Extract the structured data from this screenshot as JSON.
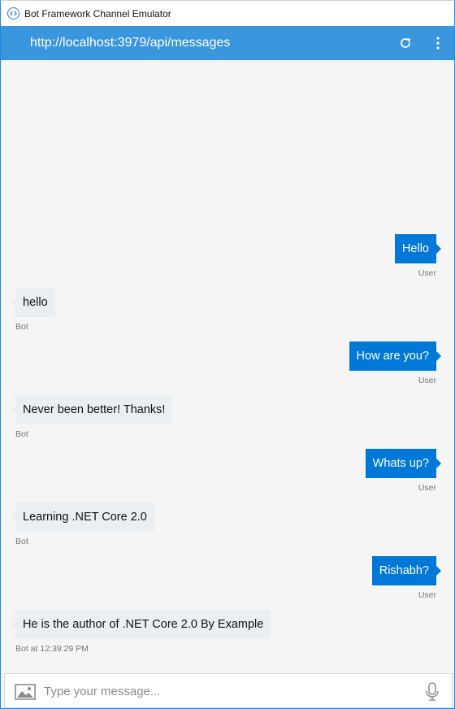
{
  "window": {
    "title": "Bot Framework Channel Emulator"
  },
  "addressbar": {
    "url": "http://localhost:3979/api/messages"
  },
  "conversation": [
    {
      "from": "user",
      "text": "Hello",
      "sender_label": "User"
    },
    {
      "from": "bot",
      "text": "hello",
      "sender_label": "Bot"
    },
    {
      "from": "user",
      "text": "How are you?",
      "sender_label": "User"
    },
    {
      "from": "bot",
      "text": "Never been better! Thanks!",
      "sender_label": "Bot"
    },
    {
      "from": "user",
      "text": "Whats up?",
      "sender_label": "User"
    },
    {
      "from": "bot",
      "text": "Learning .NET Core 2.0",
      "sender_label": "Bot"
    },
    {
      "from": "user",
      "text": "Rishabh?",
      "sender_label": "User"
    },
    {
      "from": "bot",
      "text": "He is the author of .NET Core 2.0 By Example",
      "sender_label": "Bot at 12:39:29 PM"
    }
  ],
  "input": {
    "placeholder": "Type your message..."
  },
  "icons": {
    "app": "emulator-icon",
    "refresh": "refresh-icon",
    "more": "more-vertical-icon",
    "image": "image-upload-icon",
    "mic": "microphone-icon"
  },
  "colors": {
    "accent": "#3a96dd",
    "user_bubble": "#0078d7",
    "bot_bubble": "#eceff1"
  }
}
